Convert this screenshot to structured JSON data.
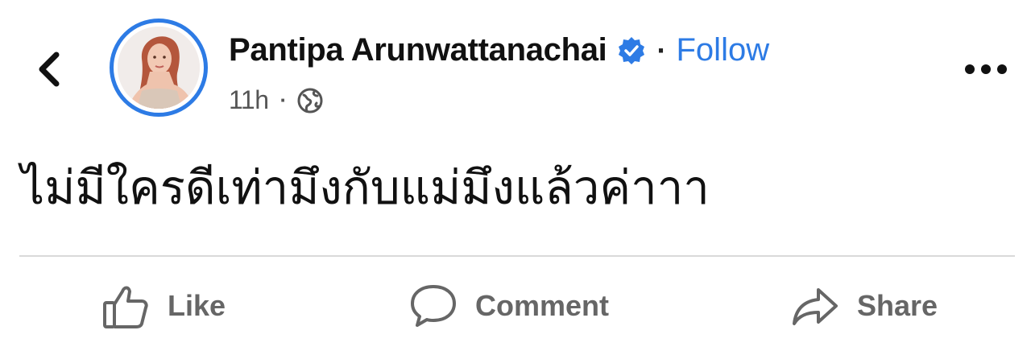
{
  "author": {
    "name": "Pantipa Arunwattanachai",
    "verified": true,
    "follow_label": "Follow",
    "separator": "·"
  },
  "meta": {
    "timestamp": "11h",
    "separator": "·",
    "audience_icon": "globe-icon"
  },
  "post": {
    "text": "ไม่มีใครดีเท่ามึงกับแม่มึงแล้วค่าาา"
  },
  "actions": [
    {
      "label": "Like",
      "icon": "thumbs-up-icon"
    },
    {
      "label": "Comment",
      "icon": "comment-icon"
    },
    {
      "label": "Share",
      "icon": "share-icon"
    }
  ],
  "icons": {
    "back": "chevron-left-icon",
    "more": "more-options-icon",
    "verified": "verified-badge-icon"
  },
  "colors": {
    "accent": "#2d7be5",
    "text": "#111111",
    "muted": "#666666",
    "divider": "#d9d9d9"
  }
}
